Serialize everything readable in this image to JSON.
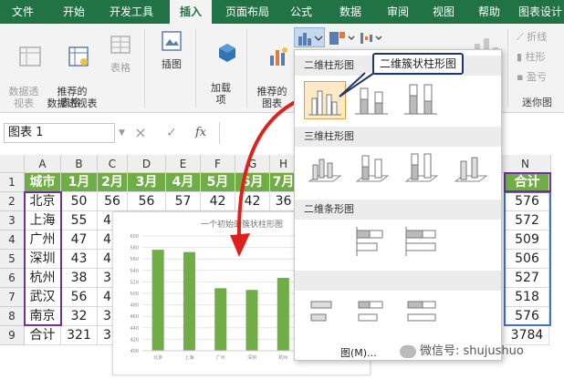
{
  "tabs": [
    "文件",
    "开始",
    "开发工具",
    "插入",
    "页面布局",
    "公式",
    "数据",
    "审阅",
    "视图",
    "帮助",
    "图表设计"
  ],
  "ribbon": {
    "pivot_label": "数据透\n视表",
    "recommended_pivot_label": "推荐的\n数据透视表",
    "table_label": "表格",
    "table_group": "表格",
    "illustrations_label": "插图",
    "addins_label": "加载\n项",
    "rec_charts_label": "推荐的\n图表",
    "sparkline_line": "折线",
    "sparkline_column": "柱形",
    "sparkline_winloss": "盈亏",
    "sparkline_group": "迷你图"
  },
  "formula_bar": {
    "name_box": "图表 1",
    "cancel": "×",
    "confirm": "✓",
    "fx": "fx"
  },
  "grid": {
    "columns": [
      "A",
      "B",
      "C",
      "D",
      "E",
      "F",
      "G",
      "H",
      "N"
    ],
    "rows": [
      "1",
      "2",
      "3",
      "4",
      "5",
      "6",
      "7",
      "8",
      "9"
    ],
    "header": [
      "城市",
      "1月",
      "2月",
      "3月",
      "4月",
      "5月",
      "6月",
      "7月"
    ],
    "total_header": "合计",
    "cities": [
      "北京",
      "上海",
      "广州",
      "深圳",
      "杭州",
      "武汉",
      "南京"
    ],
    "row2_values": [
      "50",
      "56",
      "56",
      "57",
      "42",
      "42",
      "36"
    ],
    "b_values": [
      "55",
      "47",
      "43",
      "38",
      "56",
      "32"
    ],
    "c_values": [
      "4",
      "4",
      "4",
      "3",
      "4",
      "3"
    ],
    "totals": [
      "576",
      "572",
      "509",
      "506",
      "527",
      "518",
      "576"
    ],
    "sum_label": "合计",
    "sum_b": "321",
    "sum_c": "3",
    "grand_total": "3784"
  },
  "dropdown": {
    "sec_2d_column": "二维柱形图",
    "sec_3d_column": "三维柱形图",
    "sec_2d_bar": "二维条形图",
    "more_charts": "图(M)..."
  },
  "callout_text": "二维簇状柱形图",
  "watermark": "微信号: shujushuo",
  "colors": {
    "excel_green": "#217346",
    "bar_green": "#70ad47",
    "arrow_red": "#e0201f",
    "selection_blue": "#4472c4",
    "selection_purple": "#7030a0"
  },
  "chart_data": {
    "type": "bar",
    "title": "一个初始的簇状柱形图",
    "categories": [
      "北京",
      "上海",
      "广州",
      "深圳",
      "杭州",
      "武汉",
      "南京"
    ],
    "values": [
      576,
      572,
      509,
      506,
      527,
      518,
      576
    ],
    "ylim": [
      400,
      600
    ],
    "yticks": [
      "400",
      "420",
      "440",
      "460",
      "480",
      "500",
      "520",
      "540",
      "560",
      "580",
      "600"
    ],
    "grid": true
  }
}
